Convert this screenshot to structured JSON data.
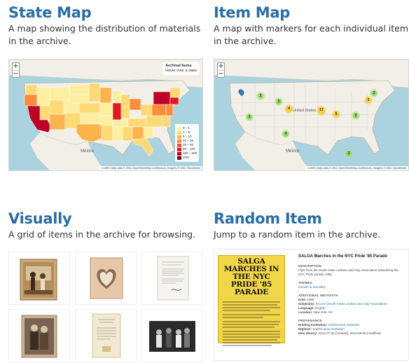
{
  "cards": {
    "state_map": {
      "title": "State Map",
      "description": "A map showing the distribution of materials in the archive.",
      "info_title": "Archival Items",
      "info_hint": "Hover over a state",
      "legend": [
        {
          "label": "0 – 1",
          "color": "#ffeda0"
        },
        {
          "label": "1 – 5",
          "color": "#fed976"
        },
        {
          "label": "5 – 10",
          "color": "#feb24c"
        },
        {
          "label": "10 – 20",
          "color": "#fd8d3c"
        },
        {
          "label": "20 – 50",
          "color": "#fc4e2a"
        },
        {
          "label": "50 – 100",
          "color": "#e31a1c"
        },
        {
          "label": "100 – 200",
          "color": "#bd0026"
        },
        {
          "label": "200+",
          "color": "#800026"
        }
      ],
      "place_labels": {
        "mexico": "México"
      },
      "attribution": "Leaflet | Map data © 2011 OpenStreetMap contributors, Imagery © 2011 CloudMade"
    },
    "item_map": {
      "title": "Item Map",
      "description": "A map with markers for each individual item in the archive.",
      "place_labels": {
        "united_states": "United States",
        "mexico": "México"
      },
      "clusters": [
        "2",
        "3",
        "4",
        "3",
        "17",
        "5",
        "2",
        "3",
        "2",
        "4",
        "3"
      ],
      "attribution": "Leaflet | Map data © 2011 OpenStreetMap contributors, Imagery © 2011 CloudMade"
    },
    "visually": {
      "title": "Visually",
      "description": "A grid of items in the archive for browsing."
    },
    "random_item": {
      "title": "Random Item",
      "description": "Jump to a random item in the archive.",
      "poster_title": "SALGA MARCHES IN THE NYC PRIDE '85 PARADE",
      "item_title": "SALGA Marches in the NYC Pride '85 Parade",
      "description_heading": "DESCRIPTION",
      "description_text": "Flyer from the South Asian Lesbian and Gay Association advertising the NYC Pride parade 1985.",
      "themes_heading": "THEMES",
      "themes_value": "Gender & Sexuality",
      "additional_heading": "ADDITIONAL METADATA",
      "date_label": "Date:",
      "date_value": "1985",
      "subjects_label": "Subject(s):",
      "subjects_value": "SALGA (South Asian Lesbian and Gay Association)",
      "language_label": "Language:",
      "language_value": "English",
      "location_label": "Location:",
      "location_value": "New York, NY",
      "provenance_heading": "PROVENANCE",
      "holding_label": "Holding Institution:",
      "holding_value": "Smithsonian Institution",
      "digitizer_label": "Digitizer:",
      "digitizer_value": "Smithsonian Institution",
      "history_label": "Item History:",
      "history_value": "2012-07-25 (created); 2013-09-30 (modified)"
    }
  },
  "colors": {
    "accent": "#2a6ea6",
    "water": "#aad3df",
    "land": "#f2efe9",
    "poster": "#f2d64a"
  }
}
